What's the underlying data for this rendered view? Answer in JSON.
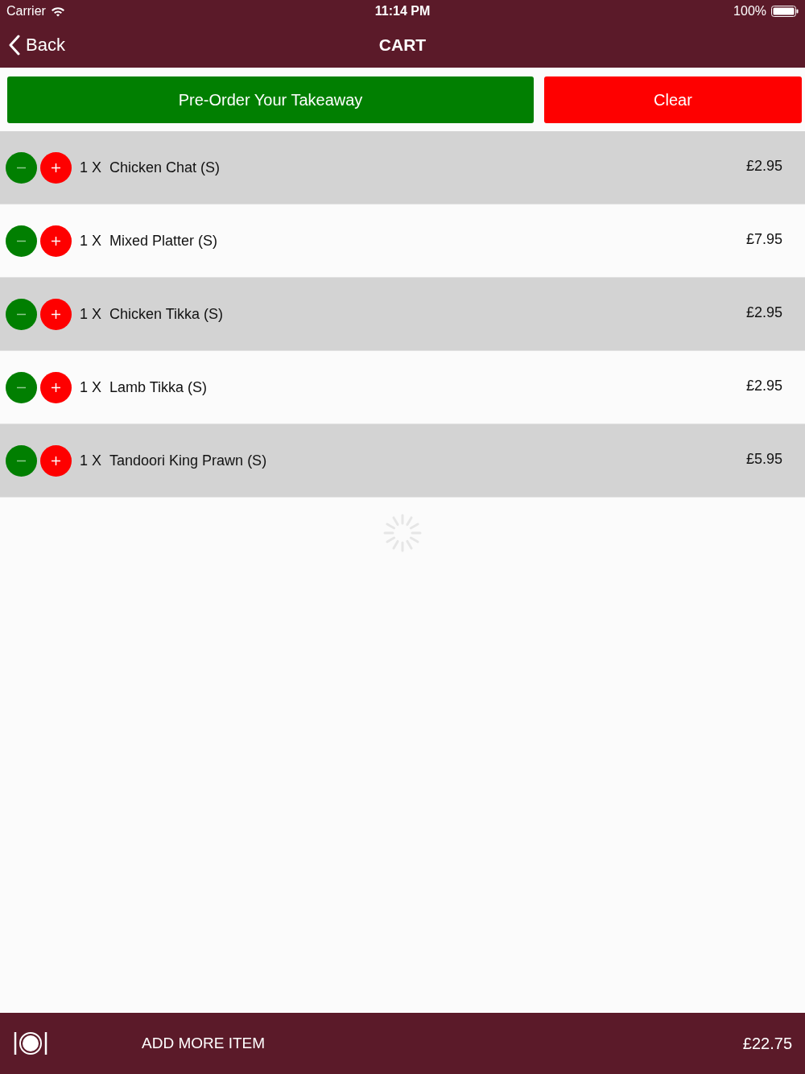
{
  "status_bar": {
    "carrier": "Carrier",
    "time": "11:14 PM",
    "battery": "100%"
  },
  "nav": {
    "back": "Back",
    "title": "CART"
  },
  "actions": {
    "preorder": "Pre-Order Your Takeaway",
    "clear": "Clear"
  },
  "items": [
    {
      "quantity": "1 X",
      "name": "Chicken Chat (S)",
      "price": "£2.95"
    },
    {
      "quantity": "1 X",
      "name": "Mixed Platter (S)",
      "price": "£7.95"
    },
    {
      "quantity": "1 X",
      "name": "Chicken Tikka (S)",
      "price": "£2.95"
    },
    {
      "quantity": "1 X",
      "name": "Lamb Tikka (S)",
      "price": "£2.95"
    },
    {
      "quantity": "1 X",
      "name": "Tandoori King Prawn (S)",
      "price": "£5.95"
    }
  ],
  "footer": {
    "add_more": "ADD MORE ITEM",
    "total": "£22.75"
  }
}
